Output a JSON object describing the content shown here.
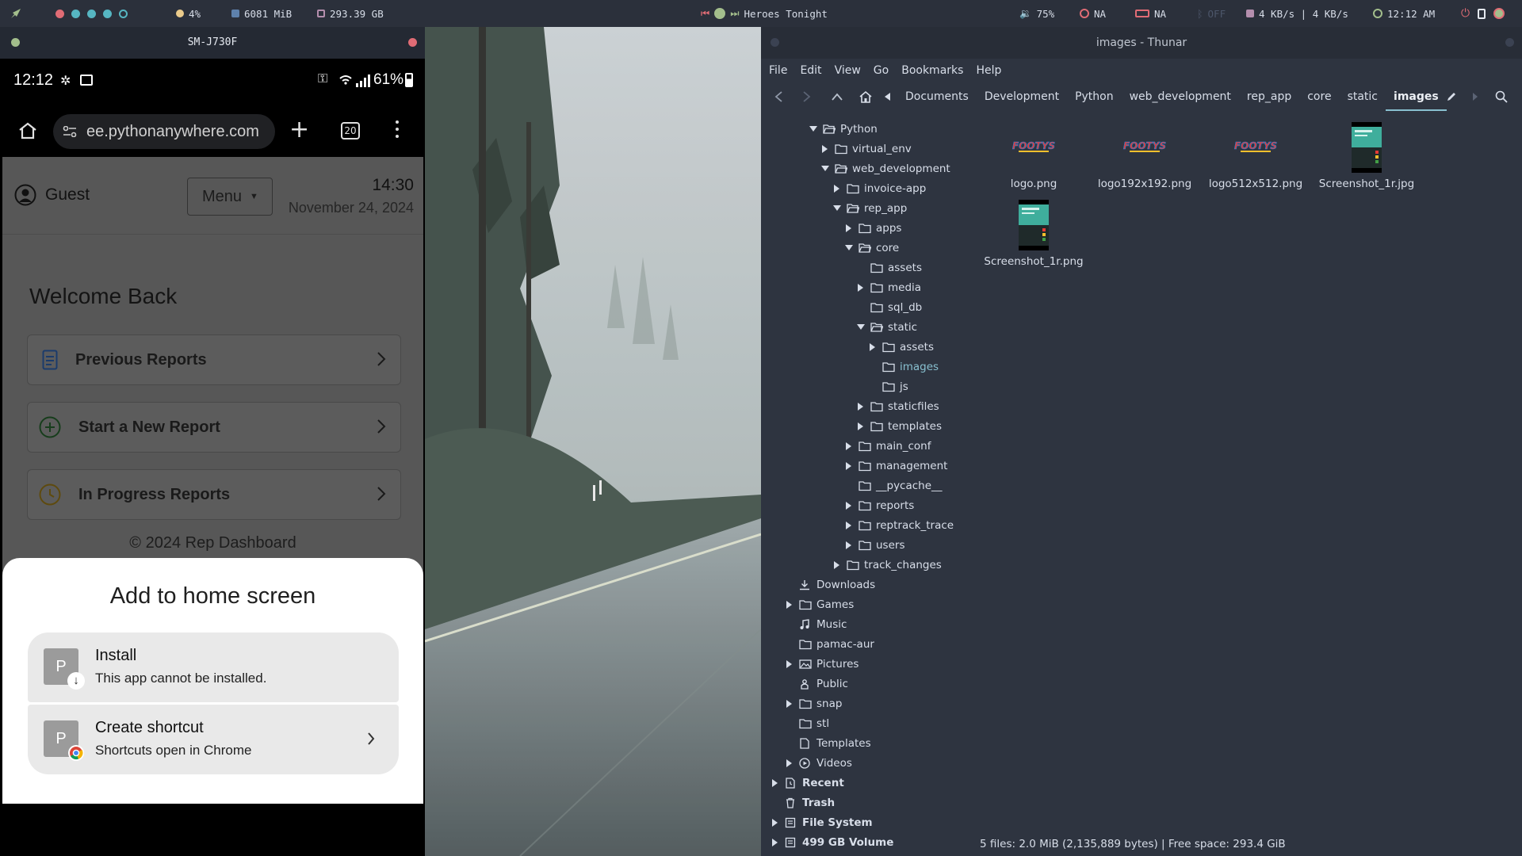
{
  "topbar": {
    "cpu": "4%",
    "mem": "6081 MiB",
    "disk": "293.39 GB",
    "media_title": "Heroes Tonight",
    "volume": "75%",
    "net1": "NA",
    "net2": "NA",
    "bt": "OFF",
    "speed": "4 KB/s | 4 KB/s",
    "clock": "12:12 AM"
  },
  "phone": {
    "window_title": "SM-J730F",
    "status": {
      "time": "12:12",
      "battery": "61%"
    },
    "url": "ee.pythonanywhere.com",
    "tab_count": "20",
    "header": {
      "user": "Guest",
      "menu_label": "Menu",
      "time": "14:30",
      "date": "November 24, 2024"
    },
    "welcome": "Welcome Back",
    "cards": [
      {
        "label": "Previous Reports"
      },
      {
        "label": "Start a New Report"
      },
      {
        "label": "In Progress Reports"
      }
    ],
    "footer": "© 2024 Rep Dashboard",
    "sheet": {
      "title": "Add to home screen",
      "install_title": "Install",
      "install_sub": "This app cannot be installed.",
      "shortcut_title": "Create shortcut",
      "shortcut_sub": "Shortcuts open in Chrome",
      "icon_letter": "P"
    }
  },
  "thunar": {
    "title": "images - Thunar",
    "menu": [
      "File",
      "Edit",
      "View",
      "Go",
      "Bookmarks",
      "Help"
    ],
    "breadcrumbs": [
      "Documents",
      "Development",
      "Python",
      "web_development",
      "rep_app",
      "core",
      "static",
      "images"
    ],
    "tree": [
      {
        "label": "Python",
        "depth": 0,
        "exp": "open"
      },
      {
        "label": "virtual_env",
        "depth": 1,
        "exp": "closed"
      },
      {
        "label": "web_development",
        "depth": 1,
        "exp": "open"
      },
      {
        "label": "invoice-app",
        "depth": 2,
        "exp": "closed"
      },
      {
        "label": "rep_app",
        "depth": 2,
        "exp": "open"
      },
      {
        "label": "apps",
        "depth": 3,
        "exp": "closed"
      },
      {
        "label": "core",
        "depth": 3,
        "exp": "open"
      },
      {
        "label": "assets",
        "depth": 4,
        "exp": "none"
      },
      {
        "label": "media",
        "depth": 4,
        "exp": "closed"
      },
      {
        "label": "sql_db",
        "depth": 4,
        "exp": "none"
      },
      {
        "label": "static",
        "depth": 4,
        "exp": "open"
      },
      {
        "label": "assets",
        "depth": 5,
        "exp": "closed"
      },
      {
        "label": "images",
        "depth": 5,
        "exp": "none",
        "selected": true
      },
      {
        "label": "js",
        "depth": 5,
        "exp": "none"
      },
      {
        "label": "staticfiles",
        "depth": 4,
        "exp": "closed"
      },
      {
        "label": "templates",
        "depth": 4,
        "exp": "closed"
      },
      {
        "label": "main_conf",
        "depth": 3,
        "exp": "closed"
      },
      {
        "label": "management",
        "depth": 3,
        "exp": "closed"
      },
      {
        "label": "__pycache__",
        "depth": 3,
        "exp": "none"
      },
      {
        "label": "reports",
        "depth": 3,
        "exp": "closed"
      },
      {
        "label": "reptrack_trace",
        "depth": 3,
        "exp": "closed"
      },
      {
        "label": "users",
        "depth": 3,
        "exp": "closed"
      },
      {
        "label": "track_changes",
        "depth": 2,
        "exp": "closed"
      }
    ],
    "places": [
      {
        "label": "Downloads",
        "icon": "download-icon",
        "exp": "none"
      },
      {
        "label": "Games",
        "icon": "folder-icon",
        "exp": "closed"
      },
      {
        "label": "Music",
        "icon": "music-icon",
        "exp": "none"
      },
      {
        "label": "pamac-aur",
        "icon": "folder-icon",
        "exp": "none"
      },
      {
        "label": "Pictures",
        "icon": "pictures-icon",
        "exp": "closed"
      },
      {
        "label": "Public",
        "icon": "public-icon",
        "exp": "none"
      },
      {
        "label": "snap",
        "icon": "folder-icon",
        "exp": "closed"
      },
      {
        "label": "stl",
        "icon": "folder-icon",
        "exp": "none"
      },
      {
        "label": "Templates",
        "icon": "template-icon",
        "exp": "none"
      },
      {
        "label": "Videos",
        "icon": "video-icon",
        "exp": "closed"
      }
    ],
    "devices": [
      {
        "label": "Recent",
        "icon": "recent-icon",
        "exp": "closed"
      },
      {
        "label": "Trash",
        "icon": "trash-icon",
        "exp": "none"
      },
      {
        "label": "File System",
        "icon": "drive-icon",
        "exp": "closed"
      },
      {
        "label": "499 GB Volume",
        "icon": "drive-icon",
        "exp": "closed"
      }
    ],
    "files": [
      {
        "name": "logo.png",
        "kind": "logo"
      },
      {
        "name": "logo192x192.png",
        "kind": "logo"
      },
      {
        "name": "logo512x512.png",
        "kind": "logo"
      },
      {
        "name": "Screenshot_1r.jpg",
        "kind": "shot"
      },
      {
        "name": "Screenshot_1r.png",
        "kind": "shot"
      }
    ],
    "status": "5 files: 2.0 MiB (2,135,889 bytes)  |  Free space: 293.4 GiB"
  },
  "colors": {
    "accent": "#88c0d0",
    "bar": "#2b303b",
    "panel": "#2e3440"
  }
}
